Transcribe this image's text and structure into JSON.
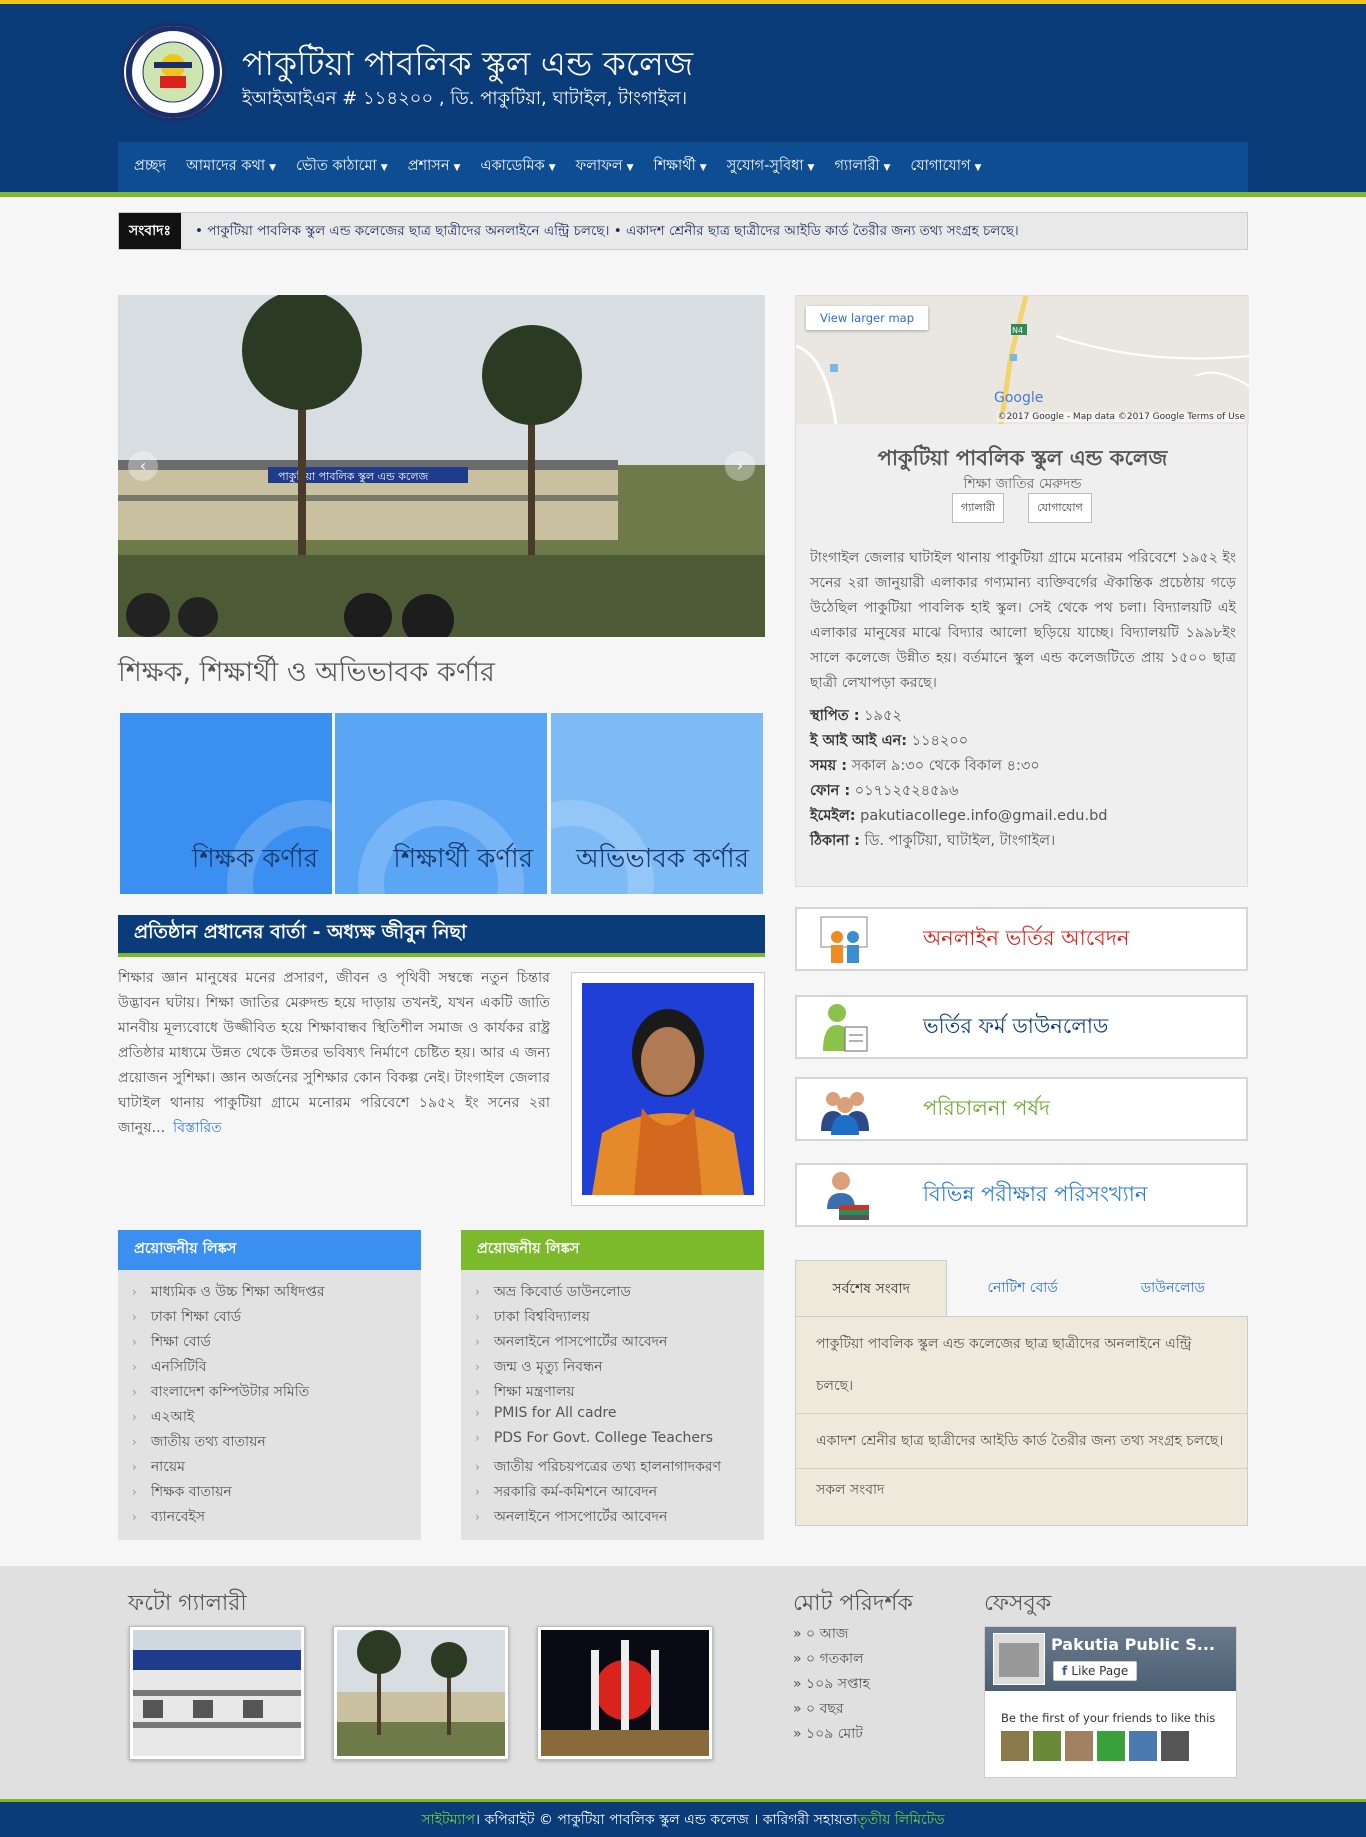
{
  "header": {
    "title": "পাকুটিয়া পাবলিক স্কুল এন্ড কলেজ",
    "subtitle": "ইআইআইএন # ১১৪২০০ , ডি. পাকুটিয়া, ঘাটাইল, টাংগাইল।",
    "logo_text": "পাকুটিয়া পাবলিক স্কুল এন্ড কলেজ"
  },
  "nav": {
    "items": [
      {
        "label": "প্রচ্ছদ",
        "caret": ""
      },
      {
        "label": "আমাদের কথা",
        "caret": "▼"
      },
      {
        "label": "ভৌত কাঠামো",
        "caret": "▼"
      },
      {
        "label": "প্রশাসন",
        "caret": "▼"
      },
      {
        "label": "একাডেমিক",
        "caret": "▼"
      },
      {
        "label": "ফলাফল",
        "caret": "▼"
      },
      {
        "label": "শিক্ষার্থী",
        "caret": "▼"
      },
      {
        "label": "সুযোগ-সুবিধা",
        "caret": "▼"
      },
      {
        "label": "গ্যালারী",
        "caret": "▼"
      },
      {
        "label": "যোগাযোগ",
        "caret": "▼"
      }
    ]
  },
  "news": {
    "label": "সংবাদঃ",
    "text": "•  পাকুটিয়া পাবলিক স্কুল এন্ড কলেজের ছাত্র ছাত্রীদের অনলাইনে এন্ট্রি চলছে।   •  একাদশ শ্রেনীর ছাত্র ছাত্রীদের আইডি কার্ড তৈরীর জন্য তথ্য সংগ্রহ চলছে।"
  },
  "slider": {
    "prev": "‹",
    "next": "›",
    "banner": "পাকুটিয়া পাবলিক স্কুল এন্ড কলেজ"
  },
  "corners": {
    "title": "শিক্ষক, শিক্ষার্থী ও অভিভাবক কর্ণার",
    "items": [
      "শিক্ষক কর্ণার",
      "শিক্ষার্থী কর্ণার",
      "অভিভাবক কর্ণার"
    ]
  },
  "message": {
    "heading": "প্রতিষ্ঠান প্রধানের বার্তা - অধ্যক্ষ জীবুন নিছা",
    "text": "শিক্ষার জ্ঞান মানুষের মনের প্রসারণ, জীবন ও পৃথিবী সম্বন্ধে নতুন চিন্তার উদ্ভাবন ঘটায়। শিক্ষা জাতির মেরুদন্ড হয়ে দাড়ায় তখনই, যখন একটি জাতি মানবীয় মূল্যবোধে উজ্জীবিত হয়ে শিক্ষাবান্ধব স্থিতিশীল সমাজ ও কার্যকর রাষ্ট্র প্রতিষ্ঠার মাধ্যমে উন্নত থেকে উন্নতর ভবিষ্যৎ নির্মাণে চেষ্টিত হয়। আর এ জন্য প্রয়োজন সুশিক্ষা। জ্ঞান অর্জনের সুশিক্ষার কোন বিকল্প নেই। টাংগাইল জেলার ঘাটাইল থানায় পাকুটিয়া গ্রামে মনোরম পরিবেশে ১৯৫২ ইং সনের ২রা জানুয়...",
    "more": "বিস্তারিত"
  },
  "links_left": {
    "heading": "প্রয়োজনীয় লিঙ্কস",
    "bullet": "›",
    "items": [
      "মাধ্যমিক ও উচ্চ শিক্ষা অধিদপ্তর",
      "ঢাকা শিক্ষা বোর্ড",
      "শিক্ষা বোর্ড",
      "এনসিটিবি",
      "বাংলাদেশ কম্পিউটার সমিতি",
      "এ২আই",
      "জাতীয় তথ্য বাতায়ন",
      "নায়েম",
      "শিক্ষক বাতায়ন",
      "ব্যানবেইস"
    ]
  },
  "links_right": {
    "heading": "প্রয়োজনীয় লিঙ্কস",
    "bullet": "›",
    "items": [
      "অভ্র কিবোর্ড ডাউনলোড",
      "ঢাকা বিশ্ববিদ্যালয়",
      "অনলাইনে পাসপোর্টের আবেদন",
      "জন্ম ও মৃত্যু নিবন্ধন",
      "শিক্ষা মন্ত্রণালয়",
      "PMIS for All cadre",
      "PDS For Govt. College Teachers",
      "জাতীয় পরিচয়পত্রের তথ্য হালনাগাদকরণ",
      "সরকারি কর্ম-কমিশনে আবেদন",
      "অনলাইনে পাসপোর্টের আবেদন"
    ]
  },
  "info": {
    "map_button": "View larger map",
    "map_footer": "©2017 Google - Map data ©2017 Google   Terms of Use",
    "map_logo": "Google",
    "road_label": "N4",
    "name": "পাকুটিয়া পাবলিক স্কুল এন্ড কলেজ",
    "tagline": "শিক্ষা জাতির মেরুদন্ড",
    "btn_gallery": "গ্যালারী",
    "btn_contact": "যোগাযোগ",
    "text": "টাংগাইল জেলার ঘাটাইল থানায় পাকুটিয়া গ্রামে মনোরম পরিবেশে ১৯৫২ ইং সনের ২রা জানুয়ারী এলাকার গণ্যমান্য ব্যক্তিবর্গের ঐকান্তিক প্রচেষ্ঠায় গড়ে উঠেছিল পাকুটিয়া পাবলিক হাই স্কুল। সেই থেকে পথ চলা। বিদ্যালয়টি এই এলাকার মানুষের মাঝে বিদ্যার আলো ছড়িয়ে যাচ্ছে। বিদ্যালয়টি ১৯৯৮ইং সালে কলেজে উন্নীত হয়। বর্তমানে স্কুল এন্ড কলেজটিতে প্রায় ১৫০০ ছাত্র ছাত্রী লেখাপড়া করছে।",
    "facts": [
      {
        "k": "স্থাপিত :",
        "v": " ১৯৫২"
      },
      {
        "k": "ই আই আই এন:",
        "v": " ১১৪২০০"
      },
      {
        "k": "সময় :",
        "v": " সকাল ৯:৩০ থেকে বিকাল ৪:৩০"
      },
      {
        "k": "ফোন :",
        "v": " ০১৭১২৫২৪৫৯৬"
      },
      {
        "k": "ইমেইল:",
        "v": " pakutiacollege.info@gmail.edu.bd"
      },
      {
        "k": "ঠিকানা :",
        "v": " ডি. পাকুটিয়া, ঘাটাইল, টাংগাইল।"
      }
    ]
  },
  "cta": [
    {
      "label": "অনলাইন ভর্তির আবেদন",
      "color": "#d9231c"
    },
    {
      "label": "ভর্তির ফর্ম ডাউনলোড",
      "color": "#0b3c7a"
    },
    {
      "label": "পরিচালনা পর্ষদ",
      "color": "#6aa82a"
    },
    {
      "label": "বিভিন্ন পরীক্ষার পরিসংখ্যান",
      "color": "#2a7ad5"
    }
  ],
  "tabs": {
    "items": [
      "সর্বশেষ সংবাদ",
      "নোটিশ বোর্ড",
      "ডাউনলোড"
    ],
    "news": [
      "পাকুটিয়া পাবলিক স্কুল এন্ড কলেজের ছাত্র ছাত্রীদের অনলাইনে এন্ট্রি চলছে।",
      "একাদশ শ্রেনীর ছাত্র ছাত্রীদের আইডি কার্ড তৈরীর জন্য তথ্য সংগ্রহ চলছে।"
    ],
    "all": "সকল সংবাদ"
  },
  "footer": {
    "gallery_title": "ফটো গ্যালারী",
    "visitors_title": "মোট পরিদর্শক",
    "visitors": [
      "» ০ আজ",
      "» ০ গতকাল",
      "» ১০৯ সপ্তাহ",
      "» ০ বছর",
      "» ১০৯ মোট"
    ],
    "facebook_title": "ফেসবুক",
    "fb_name": "Pakutia Public S...",
    "fb_like": "Like Page",
    "fb_text": "Be the first of your friends to like this"
  },
  "bottom": {
    "sitemap": "সাইটম্যাপ",
    "copyright": " । কপিরাইট © পাকুটিয়া পাবলিক স্কুল এন্ড কলেজ । কারিগরী সহায়তা ",
    "vendor": "তৃতীয় লিমিটেড"
  },
  "colors": {
    "primary": "#0b3c7a",
    "accent": "#7cba2c",
    "top": "#f0c419",
    "link_blue": "#2a7ad5"
  }
}
